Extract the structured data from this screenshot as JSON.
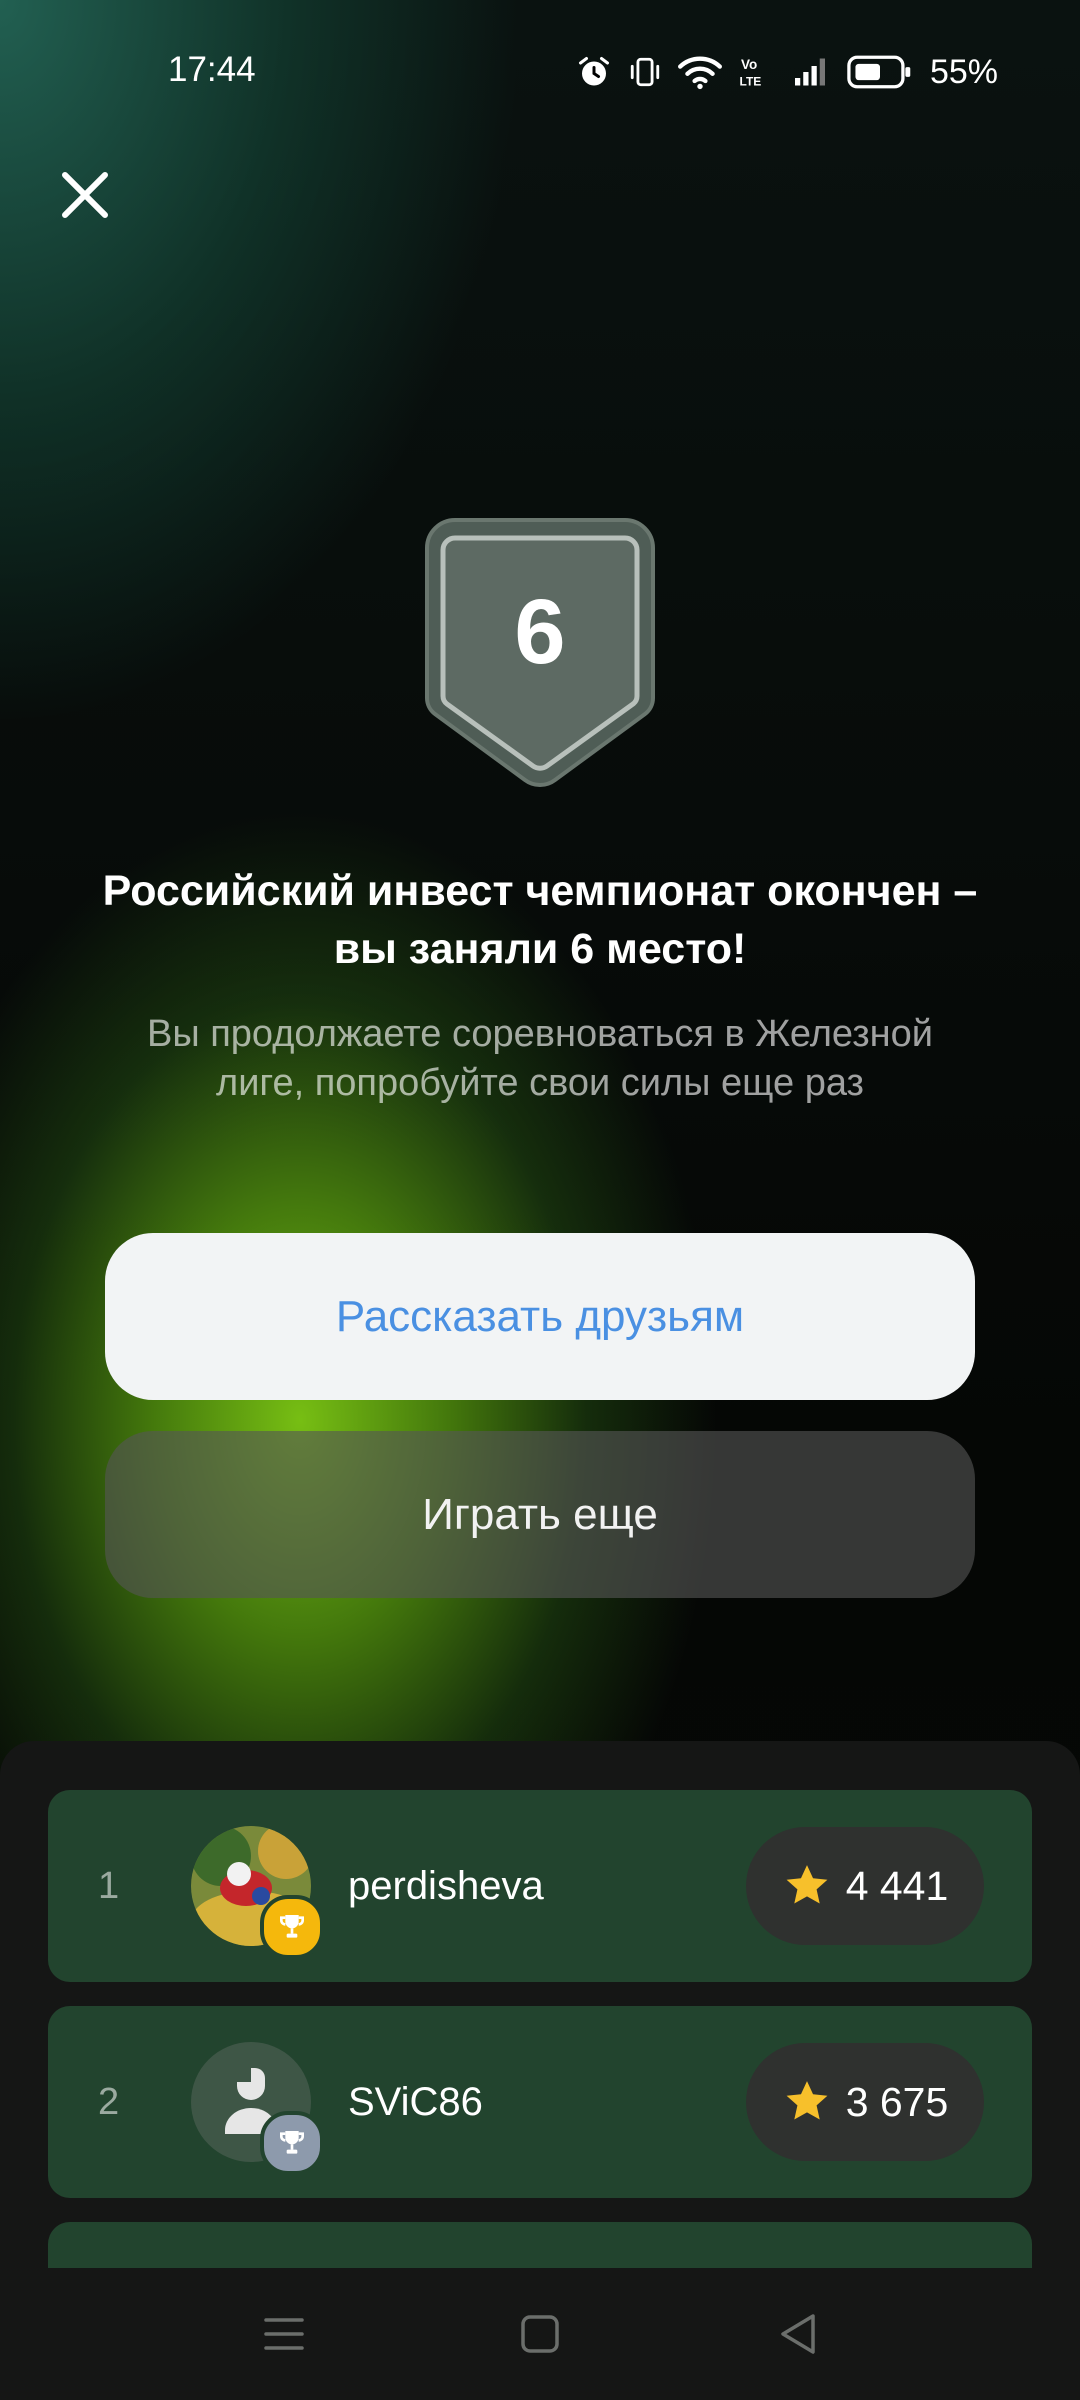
{
  "status_bar": {
    "time": "17:44",
    "battery": "55%",
    "icons": [
      "alarm-icon",
      "vibrate-icon",
      "wifi-icon",
      "volte-icon",
      "signal-icon",
      "battery-icon"
    ]
  },
  "close_icon": "close-icon",
  "badge": {
    "place": "6"
  },
  "title": "Российский инвест чемпионат окончен – вы заняли 6 место!",
  "subtitle": "Вы продолжаете соревноваться в Железной лиге, попробуйте свои силы еще раз",
  "buttons": {
    "share": "Рассказать друзьям",
    "play_again": "Играть еще"
  },
  "leaderboard": [
    {
      "rank": "1",
      "username": "perdisheva",
      "score": "4 441",
      "trophy": "gold"
    },
    {
      "rank": "2",
      "username": "SViC86",
      "score": "3 675",
      "trophy": "silver"
    }
  ],
  "colors": {
    "accent_blue": "#4a90e2",
    "row_green": "#22442e",
    "gold": "#f5b80c",
    "silver": "#8d9aac"
  },
  "navbar": [
    "menu-icon",
    "home-icon",
    "back-icon"
  ]
}
